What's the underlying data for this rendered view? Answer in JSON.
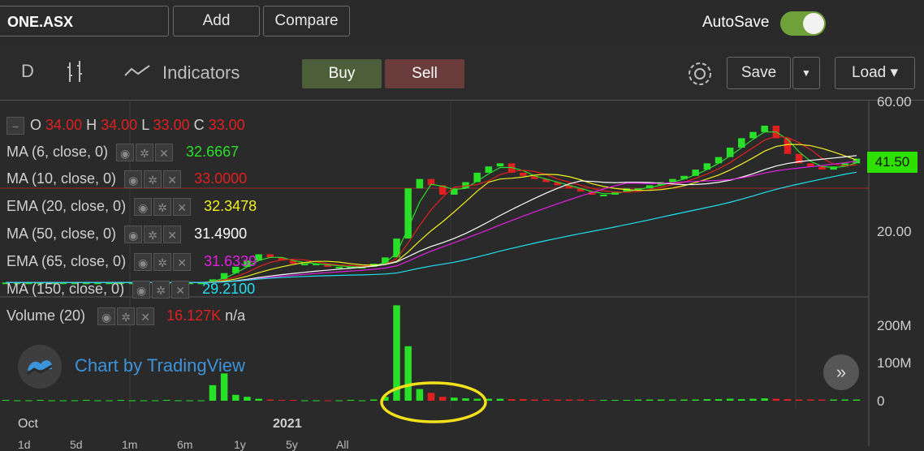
{
  "header": {
    "symbol": "ONE.ASX",
    "add_label": "Add",
    "compare_label": "Compare",
    "autosave_label": "AutoSave",
    "autosave_on": true
  },
  "toolbar": {
    "interval": "D",
    "indicators_label": "Indicators",
    "buy_label": "Buy",
    "sell_label": "Sell",
    "save_label": "Save",
    "load_label": "Load ▾"
  },
  "legend": {
    "ohlc": {
      "o_label": "O",
      "o": "34.00",
      "h_label": "H",
      "h": "34.00",
      "l_label": "L",
      "l": "33.00",
      "c_label": "C",
      "c": "33.00"
    },
    "indicators": [
      {
        "name": "MA (6, close, 0)",
        "value": "32.6667",
        "color": "#29e029"
      },
      {
        "name": "MA (10, close, 0)",
        "value": "33.0000",
        "color": "#e02020"
      },
      {
        "name": "EMA (20, close, 0)",
        "value": "32.3478",
        "color": "#f0f020"
      },
      {
        "name": "MA (50, close, 0)",
        "value": "31.4900",
        "color": "#ffffff"
      },
      {
        "name": "EMA (65, close, 0)",
        "value": "31.6339",
        "color": "#e020e0"
      },
      {
        "name": "MA (150, close, 0)",
        "value": "29.2100",
        "color": "#20e0f0"
      }
    ],
    "volume": {
      "name": "Volume (20)",
      "value": "16.127K",
      "extra": "n/a",
      "color": "#e02020"
    }
  },
  "price_axis": [
    "60.00",
    "20.00"
  ],
  "last_price": "41.50",
  "volume_axis": [
    "200M",
    "100M",
    "0"
  ],
  "time_axis": [
    "Oct",
    "2021"
  ],
  "range_buttons": [
    "1d",
    "5d",
    "1m",
    "6m",
    "1y",
    "5y",
    "All"
  ],
  "branding": "Chart by TradingView",
  "chart_data": {
    "type": "candlestick",
    "price_ylim": [
      0,
      60
    ],
    "series": [
      {
        "name": "Price (close)",
        "values": [
          2,
          2,
          2,
          2,
          2,
          2,
          2,
          2,
          2,
          2,
          2,
          2,
          2,
          2,
          2,
          2,
          2,
          2,
          3,
          5,
          7,
          9,
          11,
          10,
          9,
          8,
          8,
          8,
          7,
          7,
          7,
          7,
          8,
          10,
          16,
          32,
          35,
          33,
          30,
          32,
          34,
          37,
          39,
          40,
          37,
          36,
          35,
          34,
          33,
          32,
          31,
          30,
          30,
          31,
          32,
          32,
          33,
          34,
          35,
          36,
          38,
          40,
          42,
          45,
          48,
          50,
          52,
          48,
          43,
          40,
          39,
          38,
          39,
          40,
          41.5
        ]
      }
    ],
    "volume_ylim": [
      0,
      250
    ],
    "volume_values_M": [
      2,
      1,
      1,
      2,
      1,
      1,
      1,
      2,
      1,
      1,
      2,
      1,
      1,
      1,
      2,
      1,
      1,
      1,
      40,
      70,
      15,
      10,
      5,
      3,
      2,
      2,
      1,
      1,
      1,
      1,
      2,
      1,
      3,
      10,
      245,
      140,
      30,
      20,
      10,
      8,
      6,
      5,
      5,
      5,
      4,
      4,
      3,
      3,
      3,
      3,
      3,
      2,
      2,
      2,
      2,
      3,
      3,
      3,
      3,
      3,
      3,
      4,
      4,
      5,
      4,
      5,
      6,
      5,
      4,
      3,
      3,
      3,
      3,
      3,
      3
    ]
  }
}
